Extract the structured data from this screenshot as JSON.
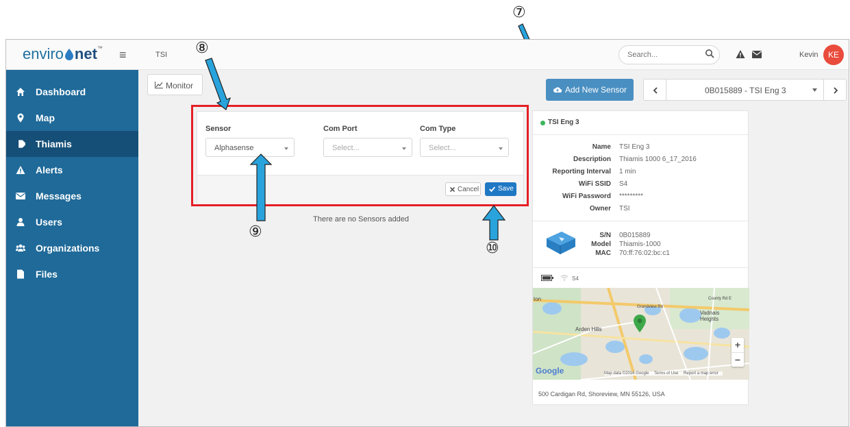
{
  "header": {
    "brand_prefix": "enviro",
    "brand_suffix": "net",
    "brand_tm": "™",
    "org": "TSI",
    "search_placeholder": "Search...",
    "username": "Kevin",
    "avatar_initials": "KE",
    "avatar_color": "#e94b3c"
  },
  "sidebar": {
    "items": [
      {
        "label": "Dashboard",
        "icon": "home-icon"
      },
      {
        "label": "Map",
        "icon": "map-pin-icon"
      },
      {
        "label": "Thiamis",
        "icon": "tag-icon",
        "active": true
      },
      {
        "label": "Alerts",
        "icon": "warning-icon"
      },
      {
        "label": "Messages",
        "icon": "envelope-icon"
      },
      {
        "label": "Users",
        "icon": "user-icon"
      },
      {
        "label": "Organizations",
        "icon": "users-icon"
      },
      {
        "label": "Files",
        "icon": "file-icon"
      }
    ]
  },
  "toolbar": {
    "monitor_label": "Monitor",
    "add_sensor_label": "Add New Sensor",
    "device_selected": "0B015889 - TSI Eng 3"
  },
  "sensor_form": {
    "sensor_label": "Sensor",
    "sensor_value": "Alphasense",
    "com_port_label": "Com Port",
    "com_port_placeholder": "Select...",
    "com_type_label": "Com Type",
    "com_type_placeholder": "Select...",
    "cancel_label": "Cancel",
    "save_label": "Save"
  },
  "empty_message": "There are no Sensors added",
  "device": {
    "title": "TSI Eng 3",
    "status_color": "#3cb55a",
    "details": [
      {
        "key": "Name",
        "value": "TSI Eng 3"
      },
      {
        "key": "Description",
        "value": "Thiamis 1000 6_17_2016"
      },
      {
        "key": "Reporting Interval",
        "value": "1 min"
      },
      {
        "key": "WiFi SSID",
        "value": "S4"
      },
      {
        "key": "WiFi Password",
        "value": "*********"
      },
      {
        "key": "Owner",
        "value": "TSI"
      }
    ],
    "hardware": [
      {
        "key": "S/N",
        "value": "0B015889"
      },
      {
        "key": "Model",
        "value": "Thiamis-1000"
      },
      {
        "key": "MAC",
        "value": "70:ff:76:02:bc:c1"
      }
    ],
    "wifi_network": "S4",
    "address": "500 Cardigan Rd, Shoreview, MN 55126, USA"
  },
  "map": {
    "labels": [
      "Arden Hills",
      "Vadnais Heights",
      "Grandview Rd",
      "County Rd E",
      "ton"
    ],
    "google_logo": "Google",
    "attribution": [
      "Map data ©2016 Google",
      "Terms of Use",
      "Report a map error"
    ],
    "zoom_in": "+",
    "zoom_out": "−"
  },
  "annotations": {
    "n7": "⑦",
    "n8": "⑧",
    "n9": "⑨",
    "n10": "⑩",
    "arrow_color": "#29a3dc"
  }
}
